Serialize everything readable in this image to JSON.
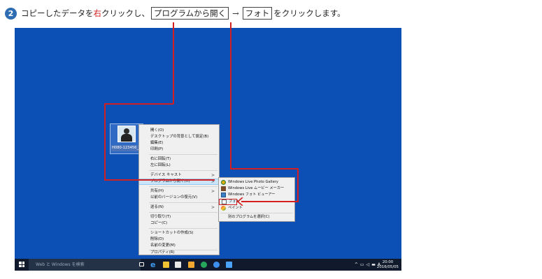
{
  "instruction": {
    "step_number": "2",
    "text_before": "コピーしたデータを",
    "text_right": "右",
    "text_after_right": "クリックし、",
    "button_1": "プログラムから開く",
    "arrow": "→",
    "button_2": "フォト",
    "text_end": "をクリックします。"
  },
  "desktop": {
    "background": "#0c50b6",
    "file_label": "H080-123456_C"
  },
  "context_menu": {
    "items": [
      "開く(O)",
      "デスクトップの背景として設定(B)",
      "編集(E)",
      "印刷(P)",
      "右に回転(T)",
      "左に回転(L)",
      "デバイス キャスト",
      "プログラムから開く(H)",
      "共有(H)",
      "以前のバージョンの復元(V)",
      "送る(N)",
      "切り取り(T)",
      "コピー(C)",
      "ショートカットの作成(S)",
      "削除(D)",
      "名前の変更(M)",
      "プロパティ(R)"
    ]
  },
  "submenu": {
    "items": [
      "Windows Live Photo Gallery",
      "Windows Live ムービー メーカー",
      "Windows フォト ビューアー",
      "フォト",
      "ペイント",
      "別のプログラムを選択(C)"
    ]
  },
  "taskbar": {
    "search_placeholder": "Web と Windows を検索",
    "tray_ime": "A",
    "clock_time": "20:00",
    "clock_date": "2016/05/05"
  },
  "colors": {
    "annotation": "#d31f1f",
    "highlight": "#cce4f7"
  },
  "icons": [
    "windows-logo-icon",
    "task-view-icon",
    "edge-icon",
    "explorer-icon",
    "store-icon",
    "chevron-right-icon"
  ]
}
